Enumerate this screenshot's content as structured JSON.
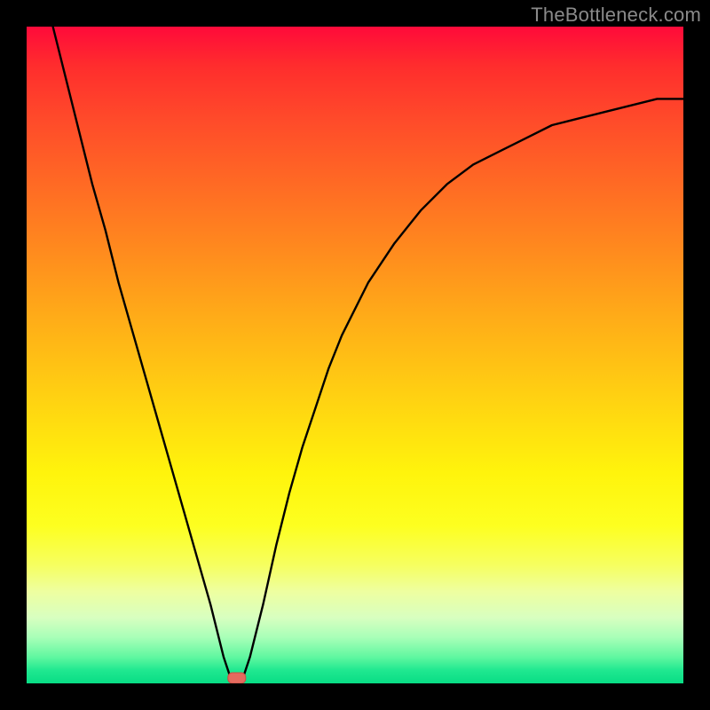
{
  "watermark": "TheBottleneck.com",
  "chart_data": {
    "type": "line",
    "title": "",
    "xlabel": "",
    "ylabel": "",
    "xlim": [
      0,
      100
    ],
    "ylim": [
      0,
      100
    ],
    "grid": false,
    "legend": null,
    "background_gradient": {
      "direction": "vertical",
      "stops": [
        {
          "pos": 0,
          "color": "#ff0a3a"
        },
        {
          "pos": 50,
          "color": "#ffc210"
        },
        {
          "pos": 80,
          "color": "#f8ff50"
        },
        {
          "pos": 100,
          "color": "#08dd85"
        }
      ]
    },
    "series": [
      {
        "name": "bottleneck-curve",
        "color": "#000000",
        "x": [
          4,
          6,
          8,
          10,
          12,
          14,
          16,
          18,
          20,
          22,
          24,
          26,
          28,
          29,
          30,
          31,
          32,
          33,
          34,
          36,
          38,
          40,
          42,
          44,
          46,
          48,
          52,
          56,
          60,
          64,
          68,
          72,
          76,
          80,
          84,
          88,
          92,
          96,
          100
        ],
        "y": [
          100,
          92,
          84,
          76,
          69,
          61,
          54,
          47,
          40,
          33,
          26,
          19,
          12,
          8,
          4,
          1,
          0,
          1,
          4,
          12,
          21,
          29,
          36,
          42,
          48,
          53,
          61,
          67,
          72,
          76,
          79,
          81,
          83,
          85,
          86,
          87,
          88,
          89,
          89
        ]
      }
    ],
    "marker": {
      "name": "optimal-point",
      "x": 32,
      "y": 0,
      "color": "#e46a5e",
      "shape": "rounded-rect"
    }
  }
}
